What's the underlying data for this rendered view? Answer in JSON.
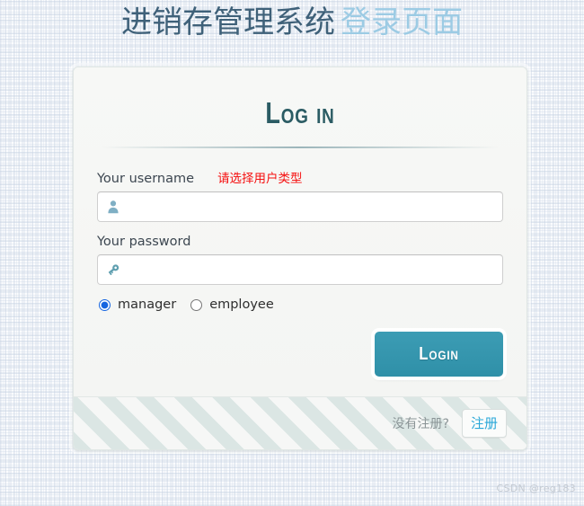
{
  "page": {
    "title_main": "进销存管理系统",
    "title_sub": "登录页面",
    "title_main_color": "#3f6179",
    "title_sub_color": "#9ccbe4"
  },
  "card": {
    "heading": "Log in",
    "heading_color": "#2b5c64",
    "form": {
      "username": {
        "label": "Your username",
        "value": "",
        "placeholder": "",
        "icon": "user-icon"
      },
      "password": {
        "label": "Your password",
        "value": "",
        "placeholder": "",
        "icon": "key-icon"
      },
      "error_message": "请选择用户类型",
      "error_color": "#f50f0f",
      "user_type": {
        "selected": "manager",
        "options": [
          {
            "value": "manager",
            "label": "manager",
            "checked": true
          },
          {
            "value": "employee",
            "label": "employee",
            "checked": false
          }
        ]
      },
      "submit_label": "Login",
      "submit_color": "#2f90a8"
    },
    "footer": {
      "prompt": "没有注册?",
      "register_label": "注册",
      "register_color": "#29a7d8"
    }
  },
  "watermark": "CSDN @reg183"
}
